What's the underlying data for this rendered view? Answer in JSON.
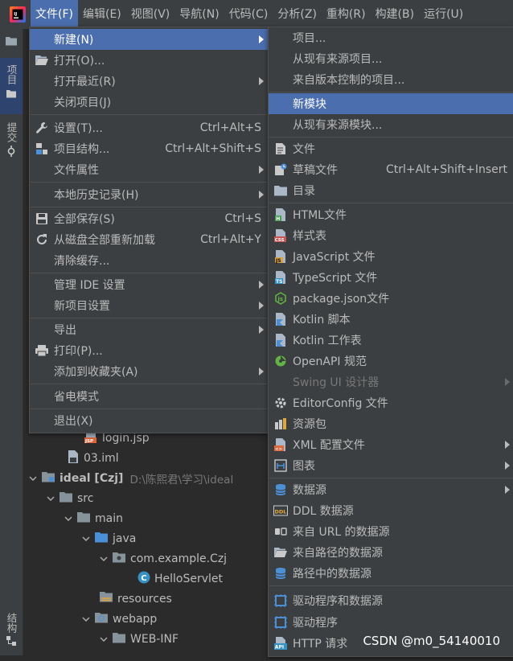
{
  "menubar": [
    "文件(F)",
    "编辑(E)",
    "视图(V)",
    "导航(N)",
    "代码(C)",
    "分析(Z)",
    "重构(R)",
    "构建(B)",
    "运行(U)"
  ],
  "toolwindows": {
    "project": "项目",
    "commit": "提交",
    "structure": "结构"
  },
  "file_menu": [
    {
      "label": "新建(N)",
      "submenu": true,
      "selected": true
    },
    {
      "label": "打开(O)...",
      "icon": "folder-open-icon"
    },
    {
      "label": "打开最近(R)",
      "submenu": true
    },
    {
      "label": "关闭项目(J)"
    },
    {
      "label": "设置(T)...",
      "shortcut": "Ctrl+Alt+S",
      "icon": "wrench-icon"
    },
    {
      "label": "项目结构...",
      "shortcut": "Ctrl+Alt+Shift+S",
      "icon": "project-structure-icon"
    },
    {
      "label": "文件属性",
      "submenu": true
    },
    {
      "label": "本地历史记录(H)",
      "submenu": true
    },
    {
      "label": "全部保存(S)",
      "shortcut": "Ctrl+S",
      "icon": "save-icon"
    },
    {
      "label": "从磁盘全部重新加载",
      "shortcut": "Ctrl+Alt+Y",
      "icon": "reload-icon"
    },
    {
      "label": "清除缓存..."
    },
    {
      "label": "管理 IDE 设置",
      "submenu": true
    },
    {
      "label": "新项目设置",
      "submenu": true
    },
    {
      "label": "导出",
      "submenu": true
    },
    {
      "label": "打印(P)...",
      "icon": "printer-icon"
    },
    {
      "label": "添加到收藏夹(A)",
      "submenu": true
    },
    {
      "label": "省电模式"
    },
    {
      "label": "退出(X)"
    }
  ],
  "new_menu": [
    {
      "label": "项目..."
    },
    {
      "label": "从现有来源项目..."
    },
    {
      "label": "来自版本控制的项目..."
    },
    {
      "label": "新模块",
      "selected": true
    },
    {
      "label": "从现有来源模块..."
    },
    {
      "label": "文件",
      "icon": "file-icon"
    },
    {
      "label": "草稿文件",
      "shortcut": "Ctrl+Alt+Shift+Insert",
      "icon": "scratch-file-icon"
    },
    {
      "label": "目录",
      "icon": "directory-icon"
    },
    {
      "label": "HTML文件",
      "icon": "html-icon"
    },
    {
      "label": "样式表",
      "icon": "css-icon"
    },
    {
      "label": "JavaScript 文件",
      "icon": "javascript-icon"
    },
    {
      "label": "TypeScript 文件",
      "icon": "typescript-icon"
    },
    {
      "label": "package.json文件",
      "icon": "nodejs-icon"
    },
    {
      "label": "Kotlin 脚本",
      "icon": "kotlin-icon"
    },
    {
      "label": "Kotlin 工作表",
      "icon": "kotlin-worksheet-icon"
    },
    {
      "label": "OpenAPI 规范",
      "icon": "openapi-icon"
    },
    {
      "label": "Swing UI 设计器",
      "submenu": true,
      "disabled": true
    },
    {
      "label": "EditorConfig 文件",
      "icon": "editorconfig-icon"
    },
    {
      "label": "资源包",
      "icon": "resource-bundle-icon"
    },
    {
      "label": "XML 配置文件",
      "submenu": true,
      "icon": "xml-icon"
    },
    {
      "label": "图表",
      "submenu": true,
      "icon": "diagram-icon"
    },
    {
      "label": "数据源",
      "submenu": true,
      "icon": "database-icon"
    },
    {
      "label": "DDL 数据源",
      "icon": "ddl-icon"
    },
    {
      "label": "来自 URL 的数据源",
      "icon": "url-datasource-icon"
    },
    {
      "label": "来自路径的数据源",
      "icon": "folder-datasource-icon"
    },
    {
      "label": "路径中的数据源",
      "icon": "path-datasource-icon"
    },
    {
      "label": "驱动程序和数据源",
      "icon": "driver-datasource-icon"
    },
    {
      "label": "驱动程序",
      "icon": "driver-icon"
    },
    {
      "label": "HTTP 请求",
      "icon": "api-icon"
    }
  ],
  "tree": [
    {
      "label": "login.jsp",
      "icon": "jsp-icon"
    },
    {
      "label": "03.iml",
      "icon": "iml-icon"
    },
    {
      "label": "ideal [Czj]",
      "path": "D:\\陈熙君\\学习\\ideal",
      "expanded": true,
      "icon": "module-icon"
    },
    {
      "label": "src",
      "expanded": true,
      "icon": "folder-icon"
    },
    {
      "label": "main",
      "expanded": true,
      "icon": "folder-icon"
    },
    {
      "label": "java",
      "expanded": true,
      "icon": "source-folder-icon"
    },
    {
      "label": "com.example.Czj",
      "expanded": true,
      "icon": "package-icon"
    },
    {
      "label": "HelloServlet",
      "icon": "class-icon"
    },
    {
      "label": "resources",
      "icon": "resources-folder-icon"
    },
    {
      "label": "webapp",
      "expanded": true,
      "icon": "web-folder-icon"
    },
    {
      "label": "WEB-INF",
      "expanded": true,
      "icon": "folder-icon"
    }
  ],
  "watermark": "CSDN @m0_54140010",
  "colors": {
    "menu_bg": "#3c3f41",
    "selection": "#4b6eaf",
    "editor_bg": "#2b2b2b",
    "text": "#bbbbbb"
  }
}
